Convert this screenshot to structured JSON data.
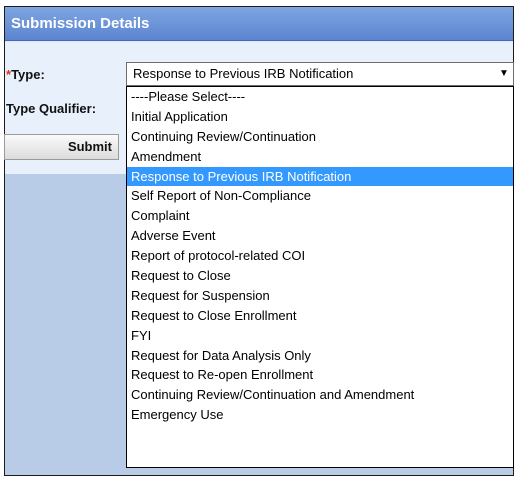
{
  "header": {
    "title": "Submission Details"
  },
  "form": {
    "type_required_mark": "*",
    "type_label": "Type:",
    "qualifier_label": "Type Qualifier:",
    "type_selected_value": "Response to Previous IRB Notification",
    "submit_label": "Submit"
  },
  "dropdown": {
    "options": [
      "----Please Select----",
      "Initial Application",
      "Continuing Review/Continuation",
      "Amendment",
      "Response to Previous IRB Notification",
      "Self Report of Non-Compliance",
      "Complaint",
      "Adverse Event",
      "Report of protocol-related COI",
      "Request to Close",
      "Request for Suspension",
      "Request to Close Enrollment",
      "FYI",
      "Request for Data Analysis Only",
      "Request to Re-open Enrollment",
      "Continuing Review/Continuation and Amendment",
      "Emergency Use"
    ],
    "highlighted_index": 4
  },
  "colors": {
    "header": "#6b93d8",
    "highlight": "#3399ff",
    "required": "#e0301e"
  },
  "icons": {
    "select_arrow": "chevron-down-icon"
  }
}
